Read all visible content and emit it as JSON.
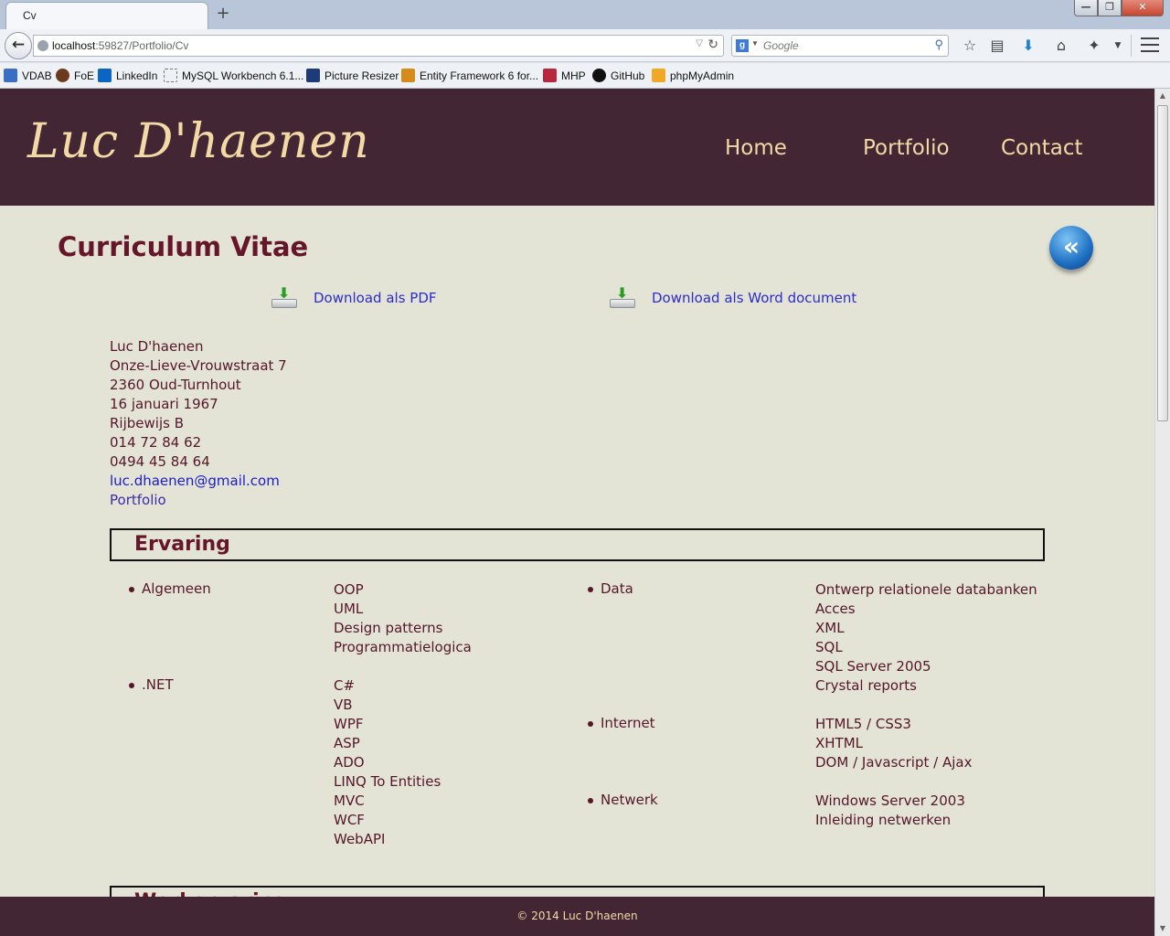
{
  "browser": {
    "tab_title": "Cv",
    "new_tab": "+",
    "url_host": "localhost",
    "url_path": ":59827/Portfolio/Cv",
    "search_placeholder": "Google",
    "search_engine_letter": "g",
    "window_controls": {
      "minimize": "—",
      "maximize": "❐",
      "close": "✕"
    },
    "toolbar_icons": [
      "bookmark-star-icon",
      "reading-list-icon",
      "download-icon",
      "home-icon",
      "addon-icon",
      "menu-icon"
    ],
    "bookmarks": [
      "VDAB",
      "FoE",
      "LinkedIn",
      "MySQL Workbench 6.1...",
      "Picture Resizer",
      "Entity Framework 6 for...",
      "MHP",
      "GitHub",
      "phpMyAdmin"
    ]
  },
  "site": {
    "logo": "Luc D'haenen",
    "nav": [
      "Home",
      "Portfolio",
      "Contact"
    ]
  },
  "page": {
    "title": "Curriculum Vitae",
    "back_icon": "back-icon",
    "downloads": [
      "Download als PDF",
      "Download als Word document"
    ],
    "contact": {
      "name": "Luc D'haenen",
      "street": "Onze-Lieve-Vrouwstraat 7",
      "city": "2360 Oud-Turnhout",
      "birthdate": "16 januari 1967",
      "license": "Rijbewijs B",
      "phone": "014 72 84 62",
      "mobile": "0494 45 84 64",
      "email": "luc.dhaenen@gmail.com",
      "portfolio": "Portfolio"
    },
    "section_ervaring": "Ervaring",
    "next_section_partial": "Werkervaring",
    "experience": {
      "left": [
        {
          "category": "Algemeen",
          "items": [
            "OOP",
            "UML",
            "Design patterns",
            "Programmatielogica"
          ]
        },
        {
          "category": ".NET",
          "items": [
            "C#",
            "VB",
            "WPF",
            "ASP",
            "ADO",
            "LINQ To Entities",
            "MVC",
            "WCF",
            "WebAPI"
          ]
        }
      ],
      "right": [
        {
          "category": "Data",
          "items": [
            "Ontwerp relationele databanken",
            "Acces",
            "XML",
            "SQL",
            "SQL Server 2005",
            "Crystal reports"
          ]
        },
        {
          "category": "Internet",
          "items": [
            "HTML5 / CSS3",
            "XHTML",
            "DOM / Javascript / Ajax"
          ]
        },
        {
          "category": "Netwerk",
          "items": [
            "Windows Server 2003",
            "Inleiding netwerken"
          ]
        }
      ]
    },
    "footer": "© 2014 Luc D'haenen"
  }
}
